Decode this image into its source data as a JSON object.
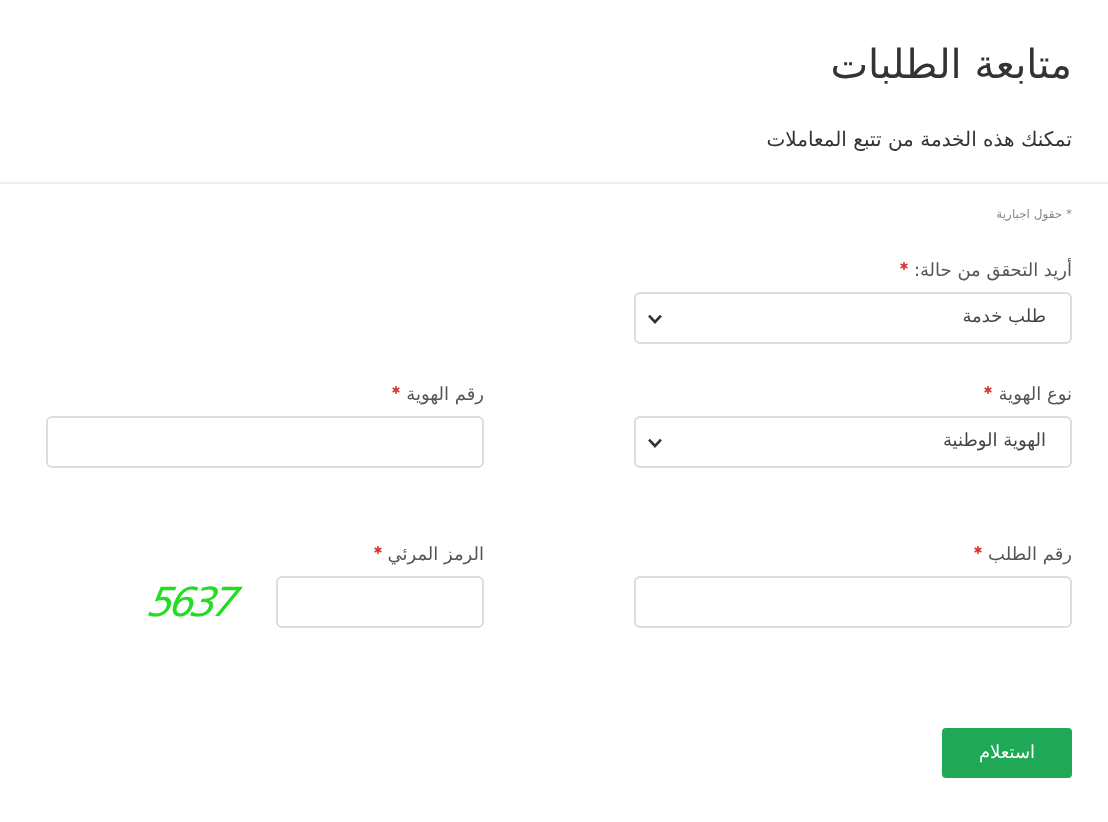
{
  "title": "متابعة الطلبات",
  "subtitle": "تمكنك هذه الخدمة من تتبع المعاملات",
  "required_note": "* حقول اجبارية",
  "rows": [
    [
      {
        "kind": "select",
        "label": "أريد التحقق من حالة:",
        "required": true,
        "value": "طلب خدمة"
      }
    ],
    [
      {
        "kind": "select",
        "label": "نوع الهوية",
        "required": true,
        "value": "الهوية الوطنية"
      },
      {
        "kind": "text",
        "label": "رقم الهوية",
        "required": true
      }
    ],
    [
      {
        "kind": "text",
        "label": "رقم الطلب",
        "required": true
      },
      {
        "kind": "captcha",
        "label": "الرمز المرئي",
        "required": true,
        "captcha_text": "5637"
      }
    ]
  ],
  "submit": "استعلام"
}
